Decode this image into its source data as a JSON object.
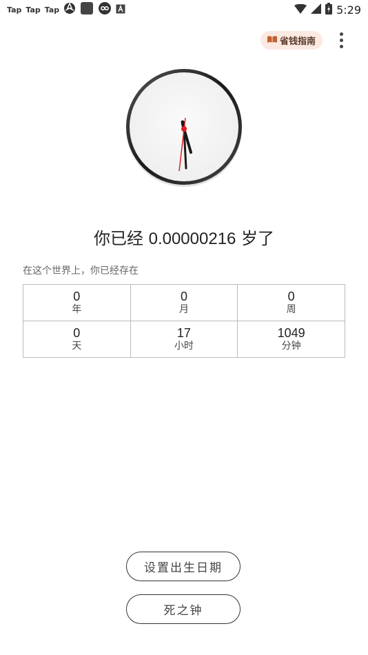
{
  "status_bar": {
    "left_items": [
      "Tap",
      "Tap",
      "Tap"
    ],
    "time": "5:29"
  },
  "header": {
    "guide_label": "省钱指南"
  },
  "age": {
    "prefix": "你已经",
    "value": "0.00000216",
    "suffix": "岁了"
  },
  "intro": "在这个世界上，你已经存在",
  "stats": {
    "years": {
      "value": "0",
      "unit": "年"
    },
    "months": {
      "value": "0",
      "unit": "月"
    },
    "weeks": {
      "value": "0",
      "unit": "周"
    },
    "days": {
      "value": "0",
      "unit": "天"
    },
    "hours": {
      "value": "17",
      "unit": "小时"
    },
    "minutes": {
      "value": "1049",
      "unit": "分钟"
    }
  },
  "buttons": {
    "set_birth": "设置出生日期",
    "death_clock": "死之钟"
  },
  "colors": {
    "guide_bg": "#fbe9e2",
    "second_hand": "#e02020",
    "clock_rim": "#2a2a2a"
  }
}
